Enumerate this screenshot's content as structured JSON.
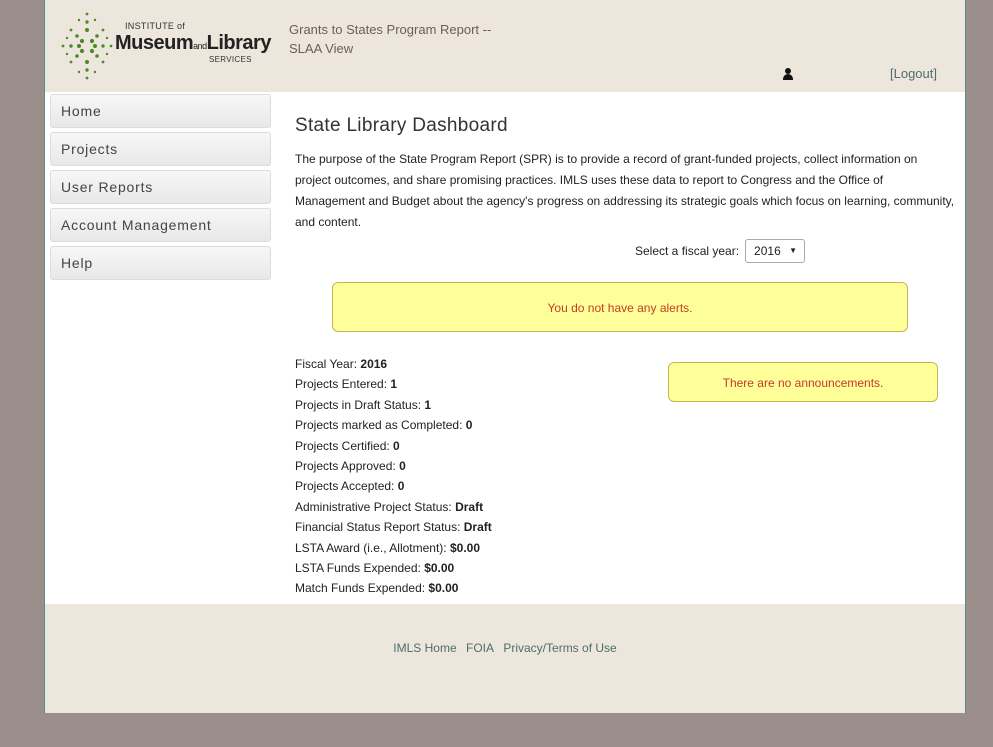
{
  "logo": {
    "small": "INSTITUTE of",
    "museum": "Museum",
    "and": "and",
    "library": "Library",
    "services": "SERVICES"
  },
  "header": {
    "title_line1": "Grants to States Program Report --",
    "title_line2": "SLAA View",
    "logout_label": "[Logout]"
  },
  "sidebar": {
    "items": [
      {
        "label": "Home"
      },
      {
        "label": "Projects"
      },
      {
        "label": "User Reports"
      },
      {
        "label": "Account Management"
      },
      {
        "label": "Help"
      }
    ]
  },
  "main": {
    "title": "State Library Dashboard",
    "intro": "The purpose of the State Program Report (SPR) is to provide a record of grant-funded projects, collect information on project outcomes, and share promising practices. IMLS uses these data to report to Congress and the Office of Management and Budget about the agency's progress on addressing its strategic goals which focus on learning, community, and content.",
    "fiscal_year_label": "Select a fiscal year:",
    "fiscal_year_value": "2016",
    "alerts_text": "You do not have any alerts.",
    "announcements_text": "There are no announcements."
  },
  "stats": [
    {
      "label": "Fiscal Year:",
      "value": "2016"
    },
    {
      "label": "Projects Entered:",
      "value": "1"
    },
    {
      "label": "Projects in Draft Status:",
      "value": "1"
    },
    {
      "label": "Projects marked as Completed:",
      "value": "0"
    },
    {
      "label": "Projects Certified:",
      "value": "0"
    },
    {
      "label": "Projects Approved:",
      "value": "0"
    },
    {
      "label": "Projects Accepted:",
      "value": "0"
    },
    {
      "label": "Administrative Project Status:",
      "value": "Draft"
    },
    {
      "label": "Financial Status Report Status:",
      "value": "Draft"
    },
    {
      "label": "LSTA Award (i.e., Allotment):",
      "value": "$0.00"
    },
    {
      "label": "LSTA Funds Expended:",
      "value": "$0.00"
    },
    {
      "label": "Match Funds Expended:",
      "value": "$0.00"
    }
  ],
  "footer": {
    "links": [
      {
        "label": "IMLS Home"
      },
      {
        "label": "FOIA"
      },
      {
        "label": "Privacy/Terms of Use"
      }
    ]
  },
  "colors": {
    "background": "#9b8f8c",
    "header_bg": "#ede6dc",
    "alert_bg": "#ffff99",
    "alert_text": "#c63a2a",
    "link": "#4b6f6c",
    "logo_green": "#4a8a2a"
  }
}
